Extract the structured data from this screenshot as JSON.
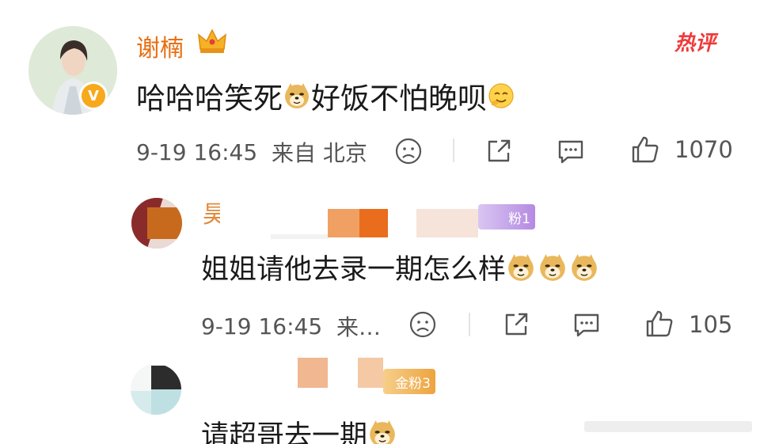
{
  "main_comment": {
    "username": "谢楠",
    "hot_tag": "热评",
    "text_part1": "哈哈哈笑死",
    "text_part2": "好饭不怕晚呗",
    "date": "9-19",
    "time": "16:45",
    "location": "来自 北京",
    "like_count": "1070",
    "verified_badge": "V"
  },
  "reply1": {
    "username_visible": "昊",
    "fan_badge": "粉1",
    "text": "姐姐请他去录一期怎么样",
    "date": "9-19",
    "time": "16:45",
    "location": "来…",
    "like_count": "105"
  },
  "reply2": {
    "fan_badge": "金粉3",
    "text": "请超哥去一期"
  },
  "icons": {
    "dislike": "sad-face-icon",
    "share": "share-icon",
    "comment": "comment-icon",
    "like": "thumbs-up-icon",
    "crown": "crown-icon",
    "doge": "doge-emoji-icon",
    "sweat": "sweat-smile-emoji-icon"
  },
  "colors": {
    "username": "#e86f12",
    "hot_tag": "#f03a3a",
    "fan_badge_purple": "#b88be0",
    "fan_badge_gold": "#f0b24a"
  }
}
